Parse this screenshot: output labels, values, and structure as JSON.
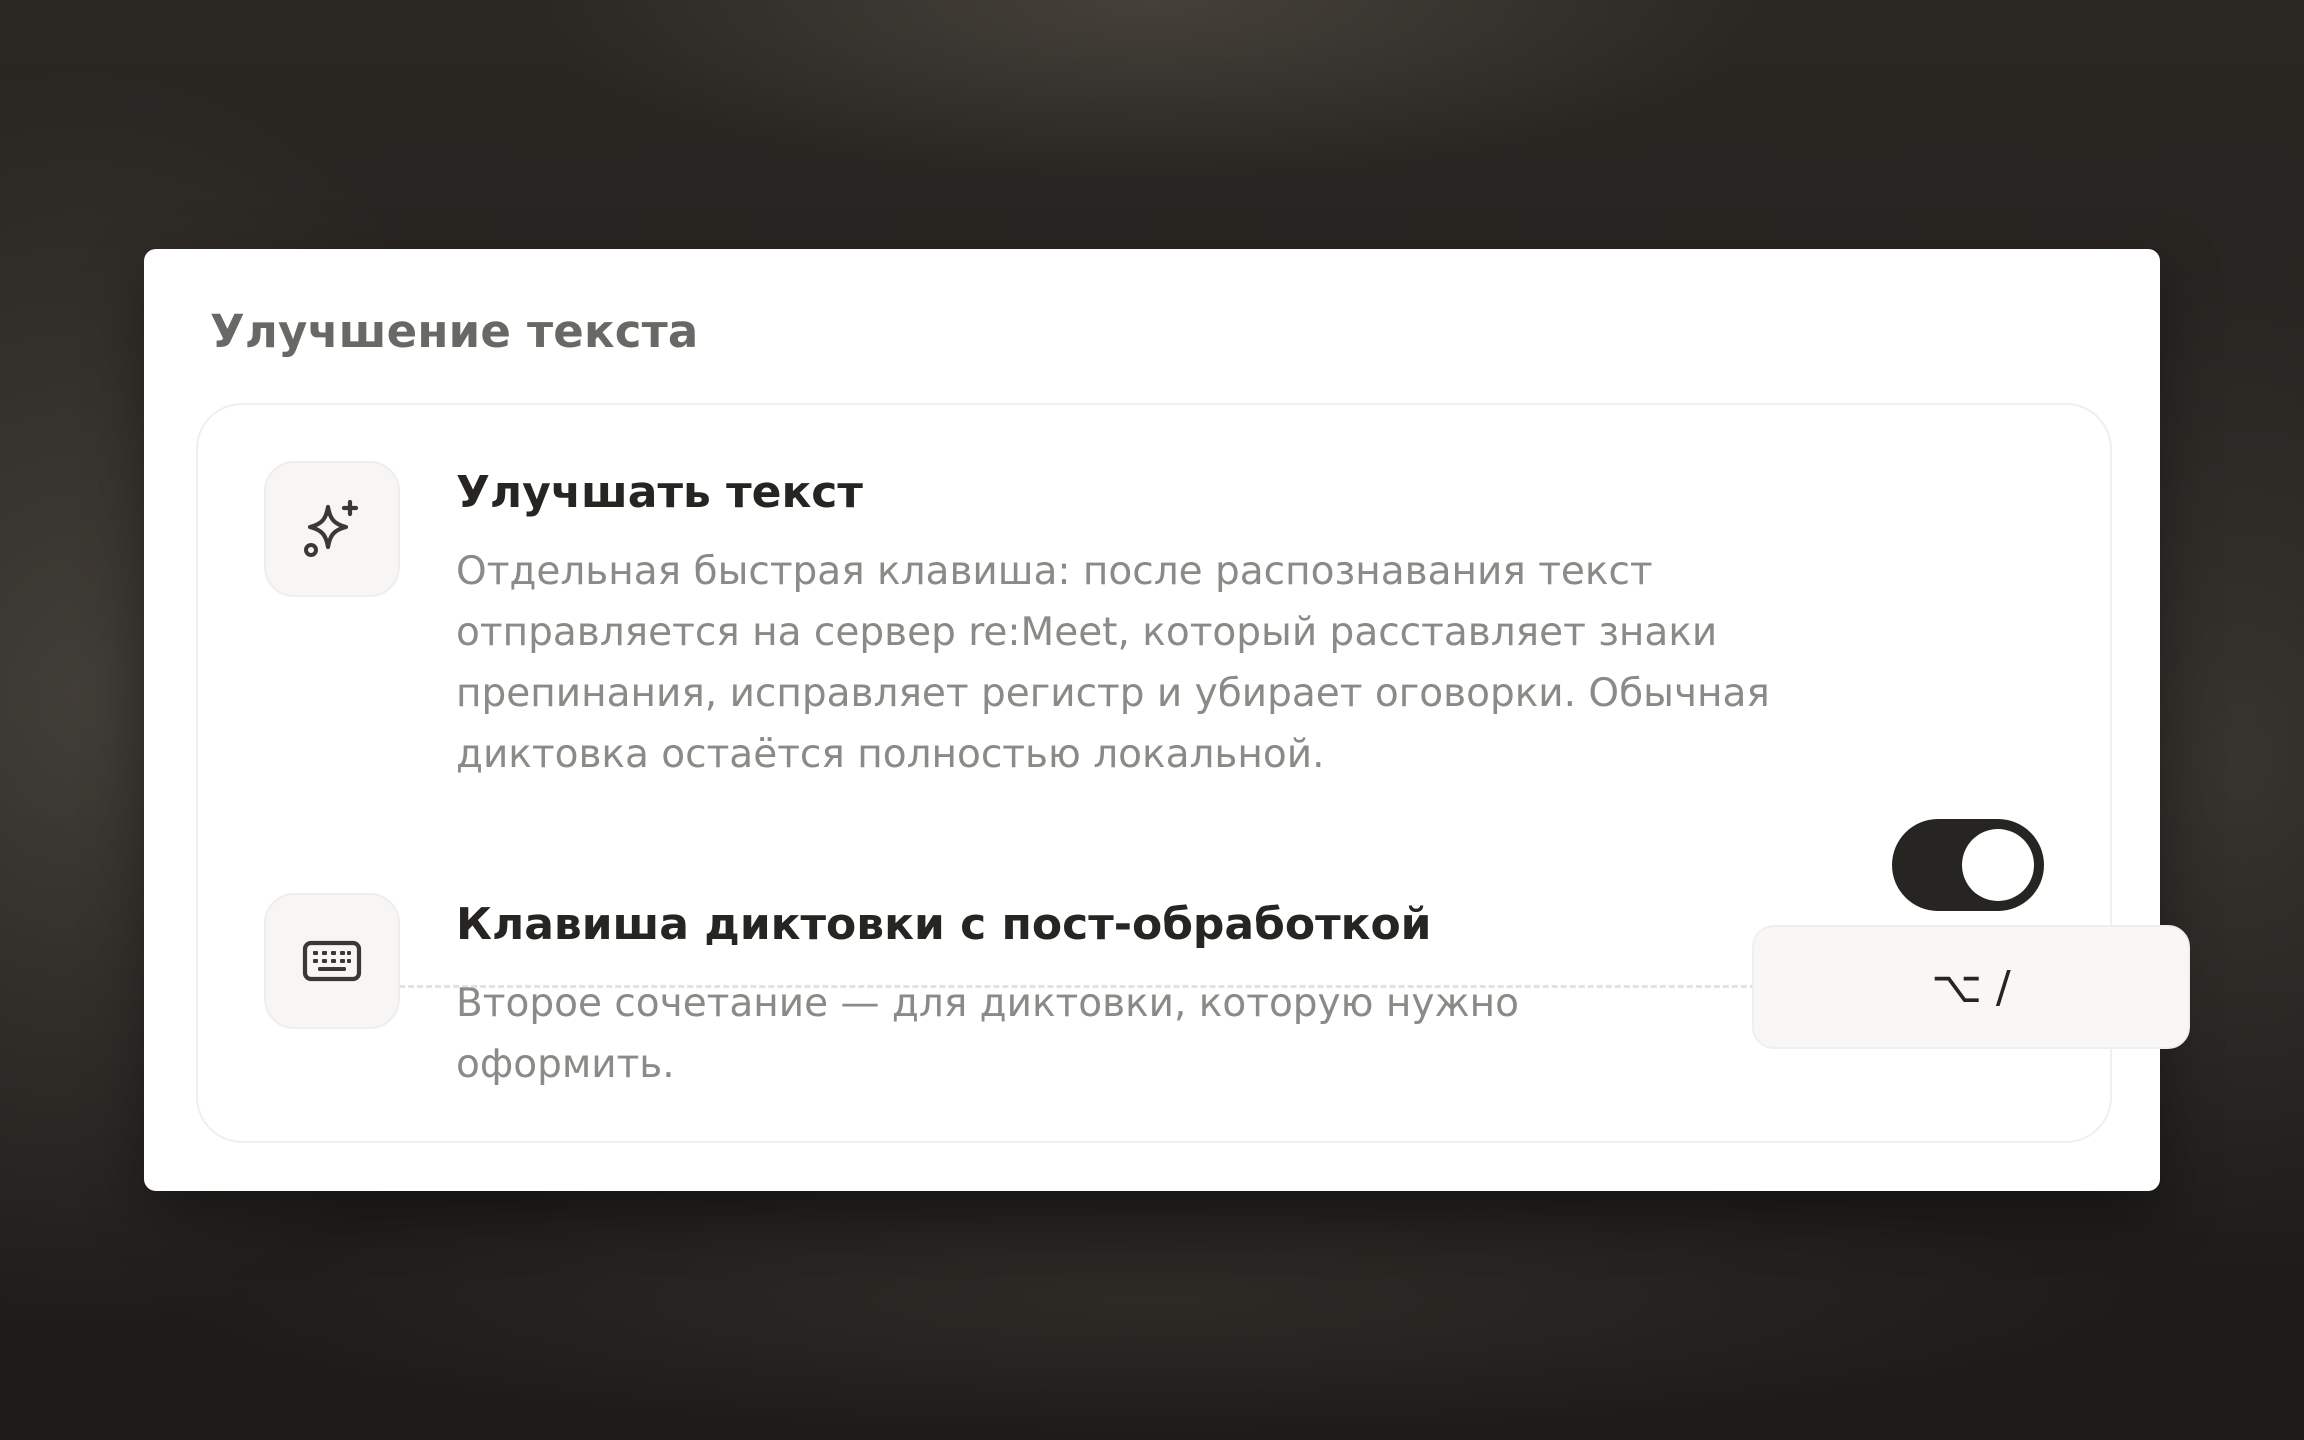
{
  "section": {
    "title": "Улучшение текста"
  },
  "enhance": {
    "icon": "sparkles-icon",
    "title": "Улучшать текст",
    "description": "Отдельная быстрая клавиша: после распознавания текст отправляется на сервер re:Meet, который расставляет знаки препинания, исправляет регистр и убирает оговорки. Обычная диктовка остаётся полностью локальной.",
    "enabled": true
  },
  "hotkey": {
    "icon": "keyboard-icon",
    "title": "Клавиша диктовки с пост-обработкой",
    "description": "Второе сочетание — для диктовки, которую нужно оформить.",
    "value": "⌥ /"
  },
  "colors": {
    "toggle_on": "#262522",
    "panel": "#ffffff",
    "title_text": "#262522",
    "muted_text": "#8c8a86"
  }
}
